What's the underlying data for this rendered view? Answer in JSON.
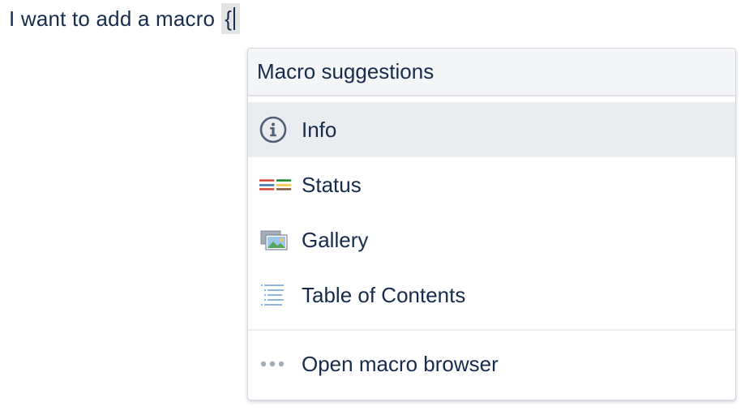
{
  "editor": {
    "text": "I want to add a macro",
    "trigger_char": "{"
  },
  "dropdown": {
    "header": "Macro suggestions",
    "items": [
      {
        "label": "Info",
        "icon": "info-icon",
        "selected": true
      },
      {
        "label": "Status",
        "icon": "status-icon",
        "selected": false
      },
      {
        "label": "Gallery",
        "icon": "gallery-icon",
        "selected": false
      },
      {
        "label": "Table of Contents",
        "icon": "table-of-contents-icon",
        "selected": false
      }
    ],
    "footer": {
      "label": "Open macro browser",
      "icon": "more-icon"
    }
  },
  "colors": {
    "text": "#172b4d",
    "header_bg": "#f4f5f7",
    "selected_bg": "#ebecf0",
    "trigger_bg": "#e4e4e4",
    "status_red": "#d04437",
    "status_blue": "#3b73af",
    "status_green": "#14892c",
    "status_yellow": "#f6c342",
    "status_brown": "#815b3a"
  }
}
